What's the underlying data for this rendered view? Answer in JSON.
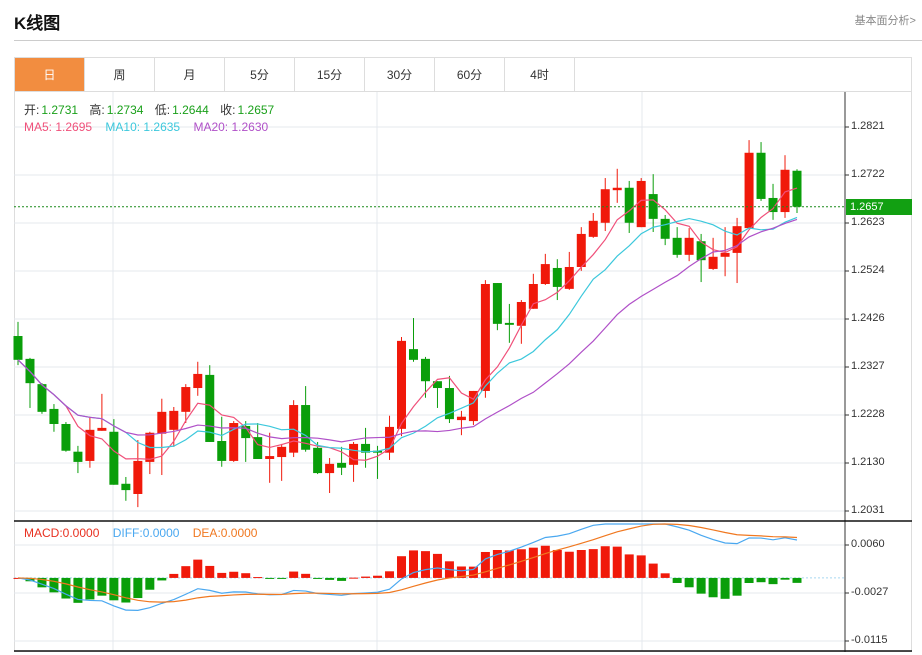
{
  "header": {
    "title": "K线图",
    "link": "基本面分析>"
  },
  "tabs": [
    {
      "label": "日",
      "active": true
    },
    {
      "label": "周"
    },
    {
      "label": "月"
    },
    {
      "label": "5分"
    },
    {
      "label": "15分"
    },
    {
      "label": "30分"
    },
    {
      "label": "60分"
    },
    {
      "label": "4时"
    }
  ],
  "ohlc_info": {
    "open_label": "开:",
    "open": "1.2731",
    "high_label": "高:",
    "high": "1.2734",
    "low_label": "低:",
    "low": "1.2644",
    "close_label": "收:",
    "close": "1.2657"
  },
  "ma_info": {
    "ma5": "MA5: 1.2695",
    "ma10": "MA10: 1.2635",
    "ma20": "MA20: 1.2630"
  },
  "macd_info": {
    "macd": "MACD:0.0000",
    "diff": "DIFF:0.0000",
    "dea": "DEA:0.0000"
  },
  "price_axis": [
    "1.2821",
    "1.2722",
    "1.2623",
    "1.2524",
    "1.2426",
    "1.2327",
    "1.2228",
    "1.2130",
    "1.2031"
  ],
  "current_price": "1.2657",
  "macd_axis": [
    "0.0060",
    "-0.0027",
    "-0.0115"
  ],
  "colors": {
    "up": "#f0190a",
    "down": "#0a9e0a",
    "ma5": "#f0507a",
    "ma10": "#3cc8dc",
    "ma20": "#b050c8",
    "diff": "#4aa8f0",
    "dea": "#f07820",
    "active_tab": "#f28d40"
  },
  "chart_data": {
    "type": "candlestick",
    "columns": [
      "open",
      "high",
      "low",
      "close"
    ],
    "candles": [
      [
        1.2391,
        1.242,
        1.2331,
        1.2342
      ],
      [
        1.2344,
        1.2346,
        1.2243,
        1.2294
      ],
      [
        1.2292,
        1.2294,
        1.2231,
        1.2235
      ],
      [
        1.2241,
        1.2251,
        1.2194,
        1.221
      ],
      [
        1.221,
        1.2214,
        1.2153,
        1.2155
      ],
      [
        1.2153,
        1.2165,
        1.2109,
        1.2132
      ],
      [
        1.2134,
        1.2225,
        1.212,
        1.2198
      ],
      [
        1.2196,
        1.2272,
        1.2196,
        1.2202
      ],
      [
        1.2194,
        1.222,
        1.2085,
        1.2085
      ],
      [
        1.2087,
        1.2101,
        1.2052,
        1.2074
      ],
      [
        1.2066,
        1.2177,
        1.2039,
        1.2134
      ],
      [
        1.2132,
        1.2194,
        1.2107,
        1.2192
      ],
      [
        1.219,
        1.2262,
        1.2105,
        1.2235
      ],
      [
        1.2198,
        1.2245,
        1.2163,
        1.2237
      ],
      [
        1.2235,
        1.2292,
        1.2212,
        1.2286
      ],
      [
        1.2284,
        1.2338,
        1.2268,
        1.2313
      ],
      [
        1.2311,
        1.2331,
        1.2173,
        1.2173
      ],
      [
        1.2175,
        1.2225,
        1.2122,
        1.2134
      ],
      [
        1.2134,
        1.2216,
        1.2132,
        1.2212
      ],
      [
        1.2206,
        1.2216,
        1.2132,
        1.2181
      ],
      [
        1.2183,
        1.2212,
        1.2138,
        1.2138
      ],
      [
        1.2138,
        1.2192,
        1.2089,
        1.2144
      ],
      [
        1.2142,
        1.2169,
        1.2093,
        1.2163
      ],
      [
        1.2151,
        1.2259,
        1.2142,
        1.2249
      ],
      [
        1.2249,
        1.2288,
        1.2153,
        1.2157
      ],
      [
        1.2161,
        1.2173,
        1.2107,
        1.2109
      ],
      [
        1.2109,
        1.214,
        1.2068,
        1.2128
      ],
      [
        1.213,
        1.2163,
        1.2105,
        1.212
      ],
      [
        1.2126,
        1.2173,
        1.2091,
        1.2169
      ],
      [
        1.2169,
        1.2202,
        1.212,
        1.2151
      ],
      [
        1.2155,
        1.2165,
        1.2097,
        1.2151
      ],
      [
        1.2151,
        1.2227,
        1.2136,
        1.2204
      ],
      [
        1.22,
        1.2389,
        1.2185,
        1.2381
      ],
      [
        1.2364,
        1.2428,
        1.2338,
        1.2342
      ],
      [
        1.2344,
        1.2348,
        1.2264,
        1.2298
      ],
      [
        1.2298,
        1.2298,
        1.2243,
        1.2284
      ],
      [
        1.2284,
        1.2309,
        1.2212,
        1.222
      ],
      [
        1.2218,
        1.2237,
        1.2187,
        1.2225
      ],
      [
        1.2216,
        1.2278,
        1.2208,
        1.2278
      ],
      [
        1.2278,
        1.2506,
        1.2264,
        1.2498
      ],
      [
        1.25,
        1.25,
        1.2403,
        1.2416
      ],
      [
        1.2418,
        1.2457,
        1.2377,
        1.2414
      ],
      [
        1.2412,
        1.2465,
        1.2375,
        1.2461
      ],
      [
        1.2447,
        1.2519,
        1.2447,
        1.2498
      ],
      [
        1.2498,
        1.256,
        1.2496,
        1.2539
      ],
      [
        1.2531,
        1.2549,
        1.2465,
        1.2492
      ],
      [
        1.2488,
        1.2564,
        1.2486,
        1.2533
      ],
      [
        1.2533,
        1.2615,
        1.2525,
        1.2601
      ],
      [
        1.2595,
        1.2644,
        1.2593,
        1.2628
      ],
      [
        1.2624,
        1.2716,
        1.2607,
        1.2693
      ],
      [
        1.2691,
        1.2735,
        1.2665,
        1.2696
      ],
      [
        1.2696,
        1.271,
        1.2603,
        1.2624
      ],
      [
        1.2615,
        1.2716,
        1.2615,
        1.271
      ],
      [
        1.2683,
        1.2724,
        1.2605,
        1.2632
      ],
      [
        1.2632,
        1.264,
        1.2578,
        1.2591
      ],
      [
        1.2593,
        1.2615,
        1.2552,
        1.2558
      ],
      [
        1.2558,
        1.2613,
        1.2545,
        1.2593
      ],
      [
        1.2586,
        1.2601,
        1.2502,
        1.2547
      ],
      [
        1.2529,
        1.2593,
        1.2527,
        1.2554
      ],
      [
        1.2554,
        1.2615,
        1.2514,
        1.2562
      ],
      [
        1.2562,
        1.2634,
        1.25,
        1.2617
      ],
      [
        1.2613,
        1.2794,
        1.2613,
        1.2768
      ],
      [
        1.2768,
        1.279,
        1.2669,
        1.2673
      ],
      [
        1.2675,
        1.2704,
        1.263,
        1.2646
      ],
      [
        1.2646,
        1.2763,
        1.2634,
        1.2733
      ],
      [
        1.2731,
        1.2734,
        1.2644,
        1.2657
      ]
    ],
    "indicators": [
      "MA5",
      "MA10",
      "MA20",
      "MACD(12,26,9)"
    ],
    "ylim": [
      1.2031,
      1.2821
    ],
    "macd_ylim": [
      -0.0115,
      0.006
    ]
  }
}
